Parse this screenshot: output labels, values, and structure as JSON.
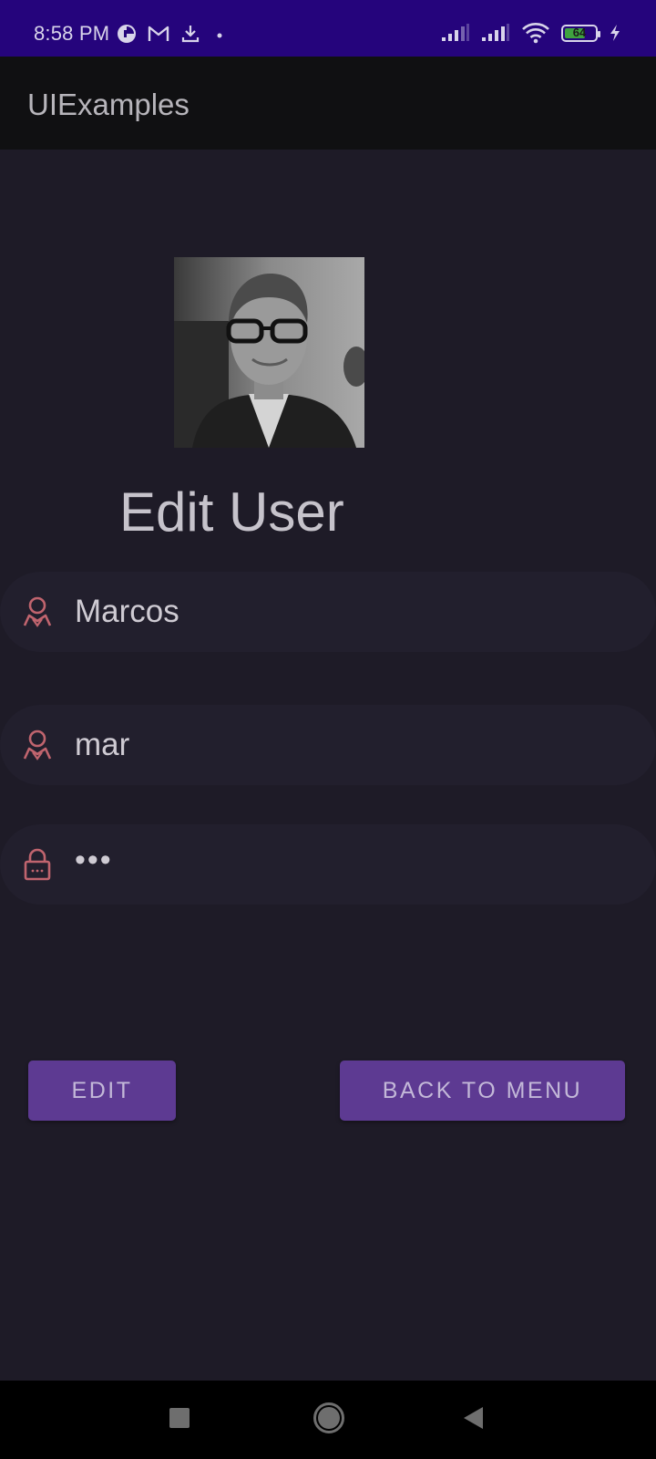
{
  "status_bar": {
    "time": "8:58 PM",
    "battery_level": "64",
    "background": "#25047c"
  },
  "app_bar": {
    "title": "UIExamples"
  },
  "page": {
    "title": "Edit User"
  },
  "form": {
    "name_value": "Marcos",
    "username_value": "mar",
    "password_value": "•••",
    "icon_color": "#c0646e"
  },
  "buttons": {
    "edit_label": "EDIT",
    "back_label": "BACK TO MENU",
    "color": "#5d3a92"
  },
  "icons": {
    "status_left": [
      "data-saver-icon",
      "gmail-icon",
      "download-icon",
      "dot-icon"
    ],
    "status_right": [
      "signal-icon",
      "signal-icon",
      "wifi-icon",
      "battery-icon",
      "charging-icon"
    ],
    "nav": [
      "recents-square-icon",
      "home-circle-icon",
      "back-triangle-icon"
    ]
  }
}
